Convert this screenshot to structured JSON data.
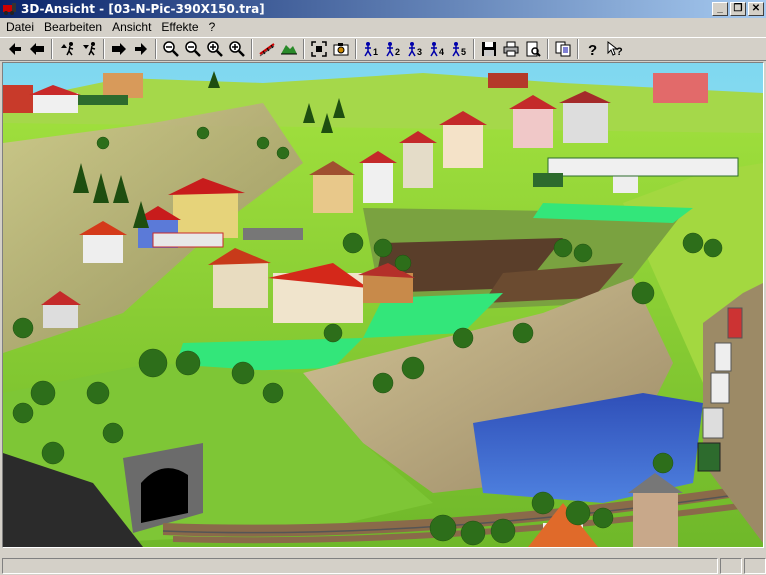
{
  "window": {
    "title": "3D-Ansicht - [03-N-Pic-390X150.tra]",
    "minimize_label": "_",
    "restore_label": "❐",
    "close_label": "✕"
  },
  "menu": {
    "items": [
      "Datei",
      "Bearbeiten",
      "Ansicht",
      "Effekte",
      "?"
    ]
  },
  "toolbar": {
    "person_labels": [
      "1",
      "2",
      "3",
      "4",
      "5"
    ],
    "icons": [
      "arrow-left-icon",
      "arrow-left-bold-icon",
      "walk-up-icon",
      "walk-down-icon",
      "arrow-right-bold-icon",
      "arrow-right-icon",
      "zoom-out-icon",
      "zoom-out-alt-icon",
      "zoom-in-icon",
      "zoom-in-alt-icon",
      "track-icon",
      "terrain-icon",
      "fit-view-icon",
      "camera-icon",
      "person-1-icon",
      "person-2-icon",
      "person-3-icon",
      "person-4-icon",
      "person-5-icon",
      "save-icon",
      "print-icon",
      "print-preview-icon",
      "copy-icon",
      "help-icon",
      "context-help-icon"
    ]
  },
  "colors": {
    "title_start": "#0a246a",
    "title_end": "#a6caf0",
    "sky": "#7fd8f0",
    "grass": "#8fd13a",
    "rock": "#c4b48a",
    "water": "#3a63c8",
    "field": "#5a3e2a",
    "lime_patch": "#33e67a"
  }
}
